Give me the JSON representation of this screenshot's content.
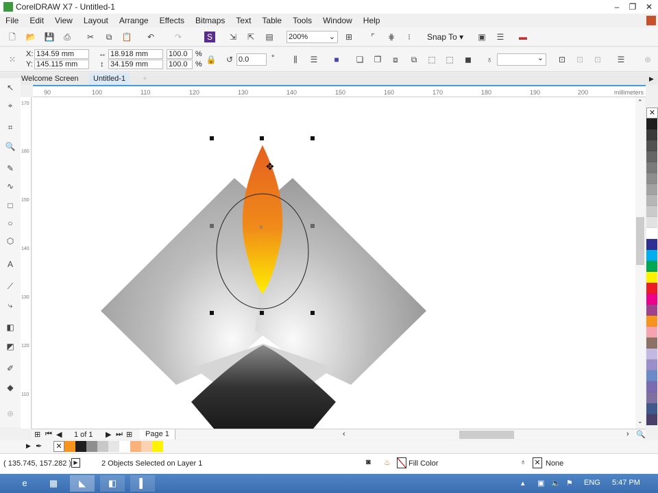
{
  "window": {
    "title": "CorelDRAW X7 - Untitled-1"
  },
  "menu": [
    "File",
    "Edit",
    "View",
    "Layout",
    "Arrange",
    "Effects",
    "Bitmaps",
    "Text",
    "Table",
    "Tools",
    "Window",
    "Help"
  ],
  "toolbar": {
    "zoom": "200%",
    "snap_to": "Snap To"
  },
  "properties": {
    "x_label": "X:",
    "x": "134.59 mm",
    "y_label": "Y:",
    "y": "145.115 mm",
    "width": "18.918 mm",
    "height": "34.159 mm",
    "scale_x": "100.0",
    "scale_y": "100.0",
    "pct": "%",
    "angle": "0.0",
    "deg": "°"
  },
  "tabs": [
    {
      "label": "Welcome Screen"
    },
    {
      "label": "Untitled-1",
      "active": true
    }
  ],
  "ruler": {
    "h_ticks": [
      "90",
      "100",
      "110",
      "120",
      "130",
      "140",
      "150",
      "160",
      "170",
      "180",
      "190",
      "200"
    ],
    "units": "millimeters",
    "v_ticks": [
      "170",
      "160",
      "150",
      "140",
      "130",
      "120",
      "110"
    ]
  },
  "pagebar": {
    "counter": "1 of 1",
    "page_tab": "Page 1"
  },
  "document_palette": [
    "#f7941d",
    "#1e1e1e",
    "#8e8e8e",
    "#c8c8c8",
    "#e6e6e6",
    "#ffffff",
    "#f9b27a",
    "#fcd3b0",
    "#fff200"
  ],
  "color_palette": [
    "#1e1e1e",
    "#3a3a3a",
    "#505050",
    "#666666",
    "#7a7a7a",
    "#8e8e8e",
    "#a2a2a2",
    "#b6b6b6",
    "#cacaca",
    "#e2e2e2",
    "#ffffff",
    "#2e3192",
    "#00aeef",
    "#00a651",
    "#fff200",
    "#ed1c24",
    "#ec008c",
    "#a0418e",
    "#f7941d",
    "#f5a3b0",
    "#8c7265",
    "#c3b9e0",
    "#9a8fc8",
    "#6a8ac8",
    "#7a6ab0",
    "#8070a0",
    "#3f5a8a",
    "#4a3f6a"
  ],
  "status": {
    "coords": "( 135.745, 157.282 )",
    "selection": "2 Objects Selected on Layer 1",
    "fill": "Fill Color",
    "outline": "None"
  },
  "taskbar": {
    "lang": "ENG",
    "time": "5:47 PM"
  }
}
